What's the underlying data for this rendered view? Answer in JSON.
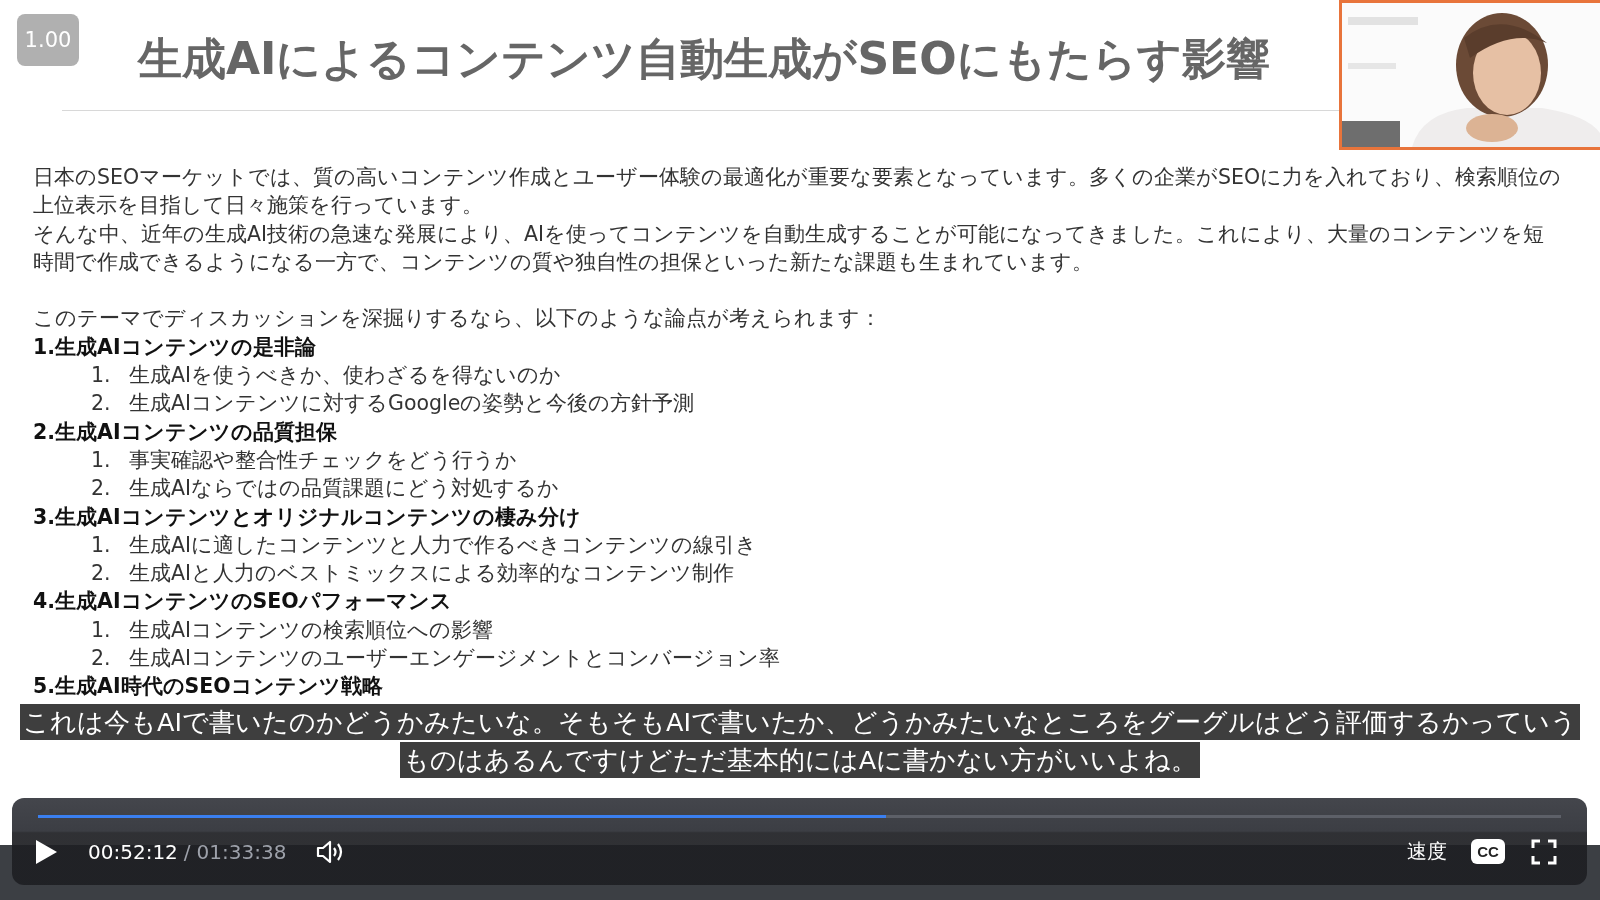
{
  "player": {
    "speed_badge": "1.00"
  },
  "slide": {
    "title": "生成AIによるコンテンツ自動生成がSEOにもたらす影響",
    "paragraphs": [
      "日本のSEOマーケットでは、質の高いコンテンツ作成とユーザー体験の最適化が重要な要素となっています。多くの企業がSEOに力を入れており、検索順位の上位表示を目指して日々施策を行っています。",
      "そんな中、近年の生成AI技術の急速な発展により、AIを使ってコンテンツを自動生成することが可能になってきました。これにより、大量のコンテンツを短時間で作成できるようになる一方で、コンテンツの質や独自性の担保といった新たな課題も生まれています。"
    ],
    "intro": "このテーマでディスカッションを深掘りするなら、以下のような論点が考えられます：",
    "sections": [
      {
        "heading": "1.生成AIコンテンツの是非論",
        "items": [
          {
            "number": "1.",
            "text": "生成AIを使うべきか、使わざるを得ないのか"
          },
          {
            "number": "2.",
            "text": "生成AIコンテンツに対するGoogleの姿勢と今後の方針予測"
          }
        ]
      },
      {
        "heading": "2.生成AIコンテンツの品質担保",
        "items": [
          {
            "number": "1.",
            "text": "事実確認や整合性チェックをどう行うか"
          },
          {
            "number": "2.",
            "text": "生成AIならではの品質課題にどう対処するか"
          }
        ]
      },
      {
        "heading": "3.生成AIコンテンツとオリジナルコンテンツの棲み分け",
        "items": [
          {
            "number": "1.",
            "text": "生成AIに適したコンテンツと人力で作るべきコンテンツの線引き"
          },
          {
            "number": "2.",
            "text": "生成AIと人力のベストミックスによる効率的なコンテンツ制作"
          }
        ]
      },
      {
        "heading": "4.生成AIコンテンツのSEOパフォーマンス",
        "items": [
          {
            "number": "1.",
            "text": "生成AIコンテンツの検索順位への影響"
          },
          {
            "number": "2.",
            "text": "生成AIコンテンツのユーザーエンゲージメントとコンバージョン率"
          }
        ]
      },
      {
        "heading": "5.生成AI時代のSEOコンテンツ戦略"
      }
    ]
  },
  "subtitles": [
    "これは今もAIで書いたのかどうかみたいな。そもそもAIで書いたか、どうかみたいなところをグーグルはどう評価するかっていう",
    "ものはあるんですけどただ基本的にはAに書かない方がいいよね。"
  ],
  "controls": {
    "progress": {
      "level": 0.557
    },
    "current_time": "00:52:12",
    "separator": "/",
    "total_time": "01:33:38",
    "speed_label": "速度",
    "cc_label": "CC"
  }
}
